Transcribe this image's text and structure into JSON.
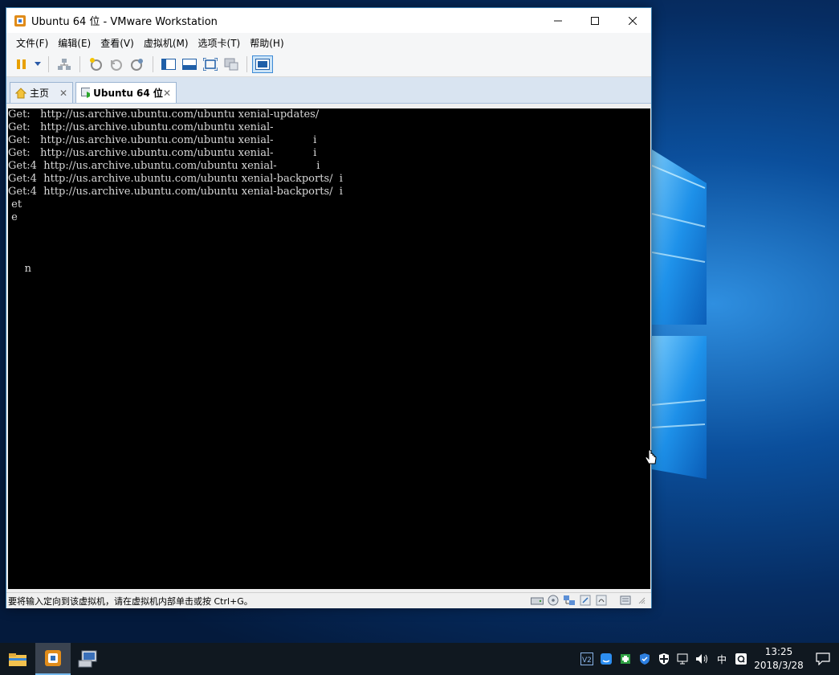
{
  "window": {
    "title": "Ubuntu 64 位 - VMware Workstation"
  },
  "menu": [
    "文件(F)",
    "编辑(E)",
    "查看(V)",
    "虚拟机(M)",
    "选项卡(T)",
    "帮助(H)"
  ],
  "tabs": {
    "home": "主页",
    "vm": "Ubuntu 64 位"
  },
  "console_lines": [
    "Get:   http://us.archive.ubuntu.com/ubuntu xenial-updates/",
    "Get:   http://us.archive.ubuntu.com/ubuntu xenial-",
    "Get:   http://us.archive.ubuntu.com/ubuntu xenial-            i",
    "Get:   http://us.archive.ubuntu.com/ubuntu xenial-            i",
    "Get:4  http://us.archive.ubuntu.com/ubuntu xenial-            i",
    "Get:4  http://us.archive.ubuntu.com/ubuntu xenial-backports/  i",
    "Get:4  http://us.archive.ubuntu.com/ubuntu xenial-backports/  i",
    " et",
    " e",
    "",
    "",
    "",
    "     n"
  ],
  "status": {
    "text": "要将输入定向到该虚拟机，请在虚拟机内部单击或按 Ctrl+G。"
  },
  "taskbar": {
    "tray_lang": "中",
    "time": "13:25",
    "date": "2018/3/28"
  },
  "colors": {
    "console_bg": "#000000",
    "console_fg": "#d8d8d8",
    "accent": "#3c8ad6"
  }
}
